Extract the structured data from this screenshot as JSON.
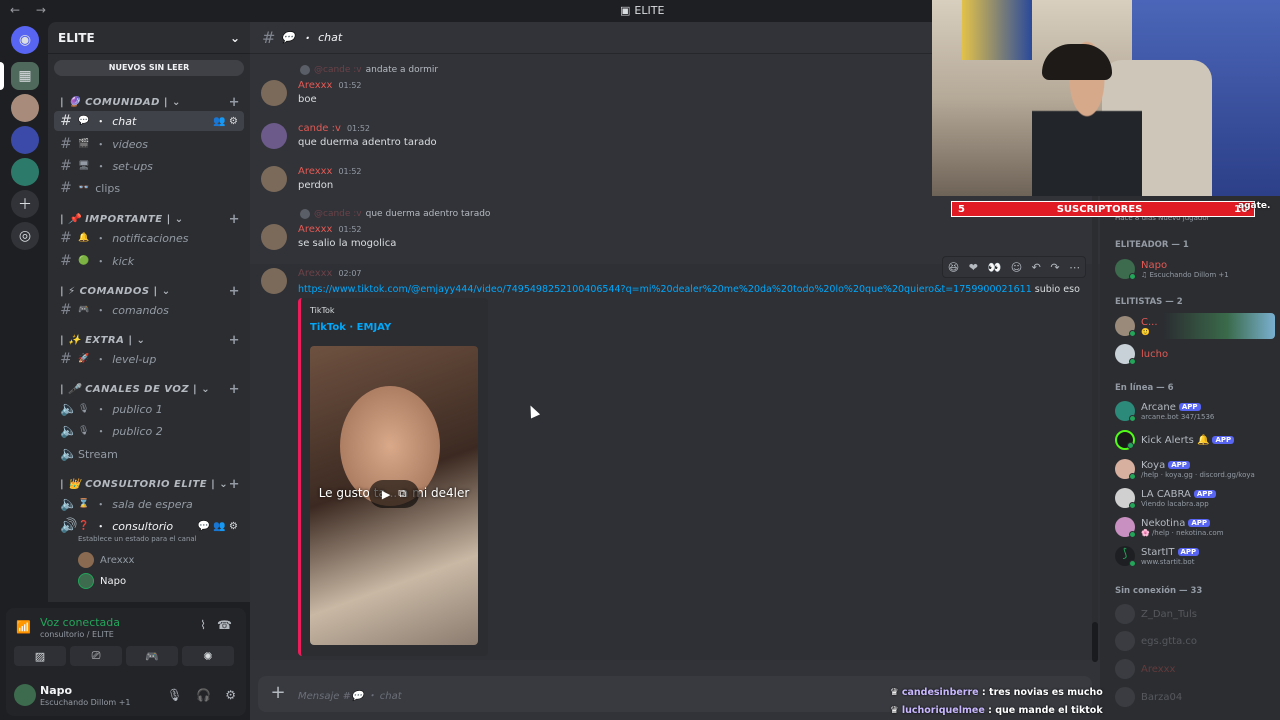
{
  "titlebar": {
    "title": "ELITE"
  },
  "guild": {
    "name": "ELITE",
    "unread_pill": "NUEVOS SIN LEER"
  },
  "categories": [
    {
      "label": "| 🔮 COMUNIDAD |"
    },
    {
      "label": "| 📌 IMPORTANTE |"
    },
    {
      "label": "| ⚡ COMANDOS |"
    },
    {
      "label": "| ✨ EXTRA |"
    },
    {
      "label": "| 🎤 CANALES DE VOZ |"
    },
    {
      "label": "| 👑 CONSULTORIO ELITE |"
    }
  ],
  "channels": [
    {
      "label": "chat"
    },
    {
      "label": "videos"
    },
    {
      "label": "set-ups"
    },
    {
      "label": "clips"
    },
    {
      "label": "notificaciones"
    },
    {
      "label": "kick"
    },
    {
      "label": "comandos"
    },
    {
      "label": "level-up"
    },
    {
      "label": "publico 1"
    },
    {
      "label": "publico 2"
    },
    {
      "label": "Stream"
    },
    {
      "label": "sala de espera"
    },
    {
      "label": "consultorio"
    }
  ],
  "channel_status": "Establece un estado para el canal",
  "voice_users": [
    "Arexxx",
    "Napo"
  ],
  "voice_panel": {
    "title": "Voz conectada",
    "sub": "consultorio / ELITE"
  },
  "user_panel": {
    "name": "Napo",
    "status": "Escuchando Dillom +1"
  },
  "chat": {
    "channel_name": "chat",
    "messages": [
      {
        "reply_name": "@cande :v",
        "reply_text": "andate a dormir",
        "author": "Arexxx",
        "time": "01:52",
        "text": "boe"
      },
      {
        "author": "cande :v",
        "time": "01:52",
        "text": "que duerma adentro tarado"
      },
      {
        "author": "Arexxx",
        "time": "01:52",
        "text": "perdon"
      },
      {
        "reply_name": "@cande :v",
        "reply_text": "que duerma adentro tarado",
        "author": "Arexxx",
        "time": "01:52",
        "text": "se salio la mogolica"
      },
      {
        "author": "Arexxx",
        "time": "02:07",
        "link": "https://www.tiktok.com/@emjayy444/video/7495498252100406544?q=mi%20dealer%20me%20da%20todo%20lo%20que%20quiero&t=1759900021611",
        "after": "subio eso"
      }
    ],
    "embed": {
      "provider": "TikTok",
      "title": "TikTok · EMJAY",
      "caption": "Le gusto ta... a mi de4ler"
    },
    "composer_placeholder": "Mensaje #💬 ・ chat"
  },
  "members": {
    "cat_eliteador": "ELITEADOR — 1",
    "cat_elitistas": "ELITISTAS — 2",
    "cat_online": "En línea — 6",
    "cat_offline": "Sin conexión — 33",
    "member_top_sub": "Hace 8 días  Nuevo jugador",
    "list": [
      {
        "name": "Napo",
        "sub": "♫ Escuchando Dillom +1"
      },
      {
        "name": "C...",
        "sub": "🙂"
      },
      {
        "name": "lucho",
        "sub": ""
      },
      {
        "name": "Arcane",
        "sub": "arcane.bot 347/1536",
        "badge": "APP"
      },
      {
        "name": "Kick Alerts 🔔",
        "sub": "",
        "badge": "APP"
      },
      {
        "name": "Koya",
        "sub": "/help · koya.gg · discord.gg/koya",
        "badge": "APP"
      },
      {
        "name": "LA CABRA",
        "sub": "Viendo lacabra.app",
        "badge": "APP"
      },
      {
        "name": "Nekotina",
        "sub": "🌸 /help · nekotina.com",
        "badge": "APP"
      },
      {
        "name": "StartIT",
        "sub": "www.startit.bot",
        "badge": "APP"
      },
      {
        "name": "Z_Dan_Tuls",
        "sub": ""
      },
      {
        "name": "egs.gtta.co",
        "sub": ""
      },
      {
        "name": "Arexxx",
        "sub": ""
      },
      {
        "name": "Barza04",
        "sub": ""
      }
    ]
  },
  "overlay": {
    "subs_count": "5",
    "subs_label": "SUSCRIPTORES",
    "subs_goal": "10",
    "subs_corner": "agate.",
    "chat": [
      {
        "user": "candesinberre",
        "text": "tres novias es mucho"
      },
      {
        "user": "luchoriquelmee",
        "text": "que mande el tiktok"
      }
    ]
  },
  "colors": {
    "accent": "#5865f2",
    "online": "#23a55a",
    "link": "#00a8fc",
    "tiktok": "#ed1c5b",
    "name_red": "#e25a55"
  }
}
